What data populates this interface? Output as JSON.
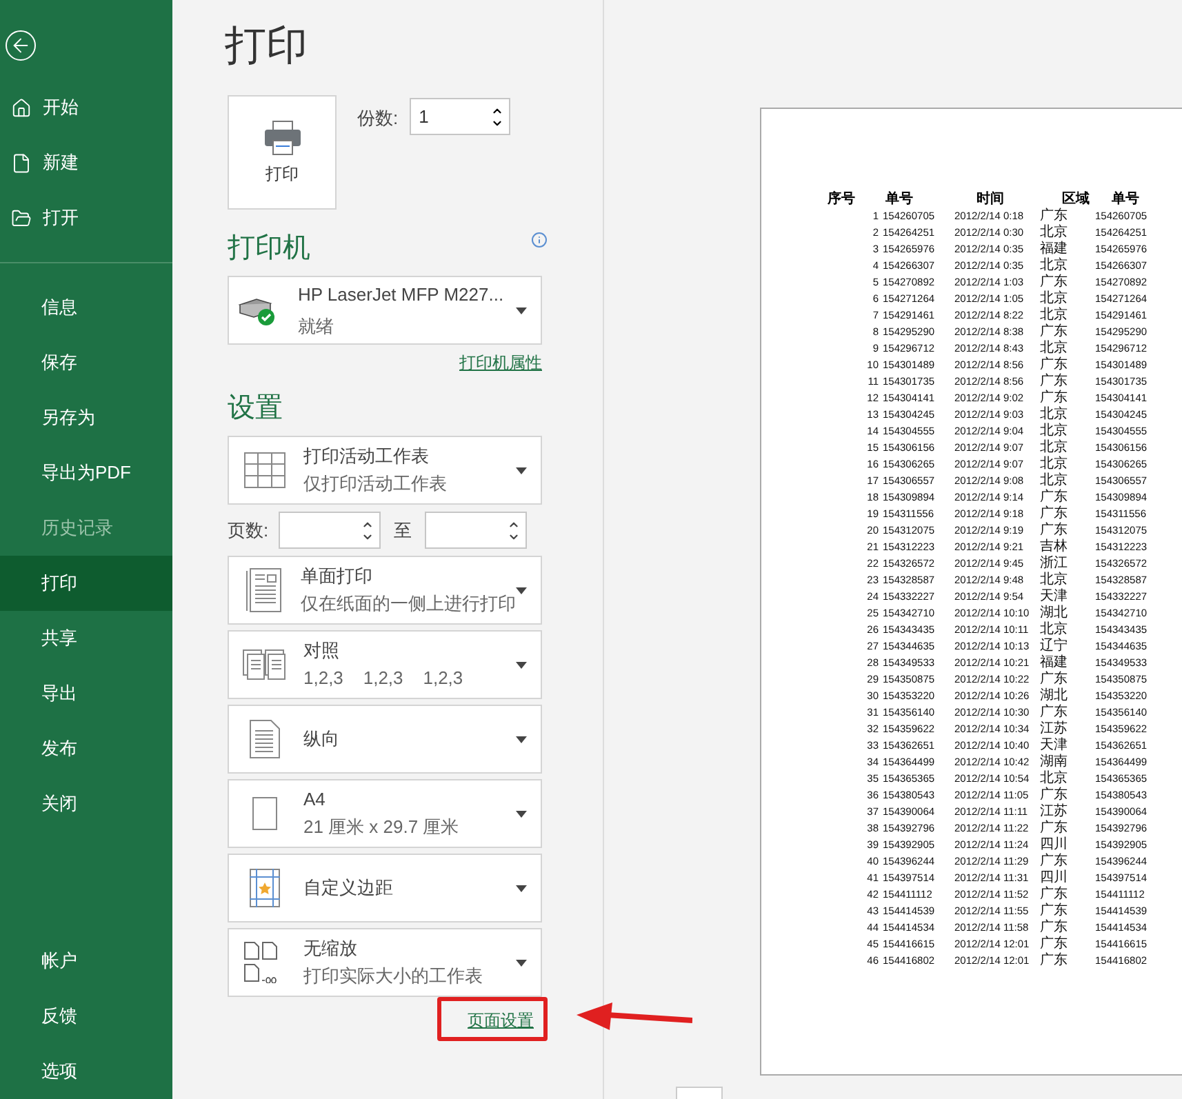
{
  "sidebar": {
    "top_items": [
      {
        "label": "开始",
        "kind": "home",
        "selected": false
      },
      {
        "label": "新建",
        "kind": "new",
        "selected": false
      },
      {
        "label": "打开",
        "kind": "open",
        "selected": false
      }
    ],
    "items": [
      {
        "label": "信息",
        "selected": false,
        "disabled": false
      },
      {
        "label": "保存",
        "selected": false,
        "disabled": false
      },
      {
        "label": "另存为",
        "selected": false,
        "disabled": false
      },
      {
        "label": "导出为PDF",
        "selected": false,
        "disabled": false
      },
      {
        "label": "历史记录",
        "selected": false,
        "disabled": true
      },
      {
        "label": "打印",
        "selected": true,
        "disabled": false
      },
      {
        "label": "共享",
        "selected": false,
        "disabled": false
      },
      {
        "label": "导出",
        "selected": false,
        "disabled": false
      },
      {
        "label": "发布",
        "selected": false,
        "disabled": false
      },
      {
        "label": "关闭",
        "selected": false,
        "disabled": false
      }
    ],
    "bottom_items": [
      {
        "label": "帐户",
        "selected": false
      },
      {
        "label": "反馈",
        "selected": false
      },
      {
        "label": "选项",
        "selected": false
      }
    ]
  },
  "title": "打印",
  "print_button": {
    "label": "打印"
  },
  "copies": {
    "label": "份数:",
    "value": "1"
  },
  "printer": {
    "heading": "打印机",
    "name": "HP LaserJet MFP M227...",
    "status": "就绪",
    "properties_link": "打印机属性"
  },
  "settings": {
    "heading": "设置",
    "options": [
      {
        "kind": "sheets",
        "title": "打印活动工作表",
        "subtitle": "仅打印活动工作表"
      },
      {
        "kind": "pages",
        "label": "页数:",
        "to": "至"
      },
      {
        "kind": "sides",
        "title": "单面打印",
        "subtitle": "仅在纸面的一侧上进行打印"
      },
      {
        "kind": "collate",
        "title": "对照",
        "subtitle": "1,2,3    1,2,3    1,2,3"
      },
      {
        "kind": "orientation",
        "title": "纵向"
      },
      {
        "kind": "paper",
        "title": "A4",
        "subtitle": "21 厘米 x 29.7 厘米"
      },
      {
        "kind": "margins",
        "title": "自定义边距"
      },
      {
        "kind": "scaling",
        "title": "无缩放",
        "subtitle": "打印实际大小的工作表"
      }
    ],
    "page_setup_link": "页面设置"
  },
  "preview": {
    "columns": [
      "序号",
      "单号",
      "时间",
      "区域",
      "单号"
    ],
    "rows": [
      [
        "1",
        "154260705",
        "2012/2/14 0:18",
        "广东",
        "154260705"
      ],
      [
        "2",
        "154264251",
        "2012/2/14 0:30",
        "北京",
        "154264251"
      ],
      [
        "3",
        "154265976",
        "2012/2/14 0:35",
        "福建",
        "154265976"
      ],
      [
        "4",
        "154266307",
        "2012/2/14 0:35",
        "北京",
        "154266307"
      ],
      [
        "5",
        "154270892",
        "2012/2/14 1:03",
        "广东",
        "154270892"
      ],
      [
        "6",
        "154271264",
        "2012/2/14 1:05",
        "北京",
        "154271264"
      ],
      [
        "7",
        "154291461",
        "2012/2/14 8:22",
        "北京",
        "154291461"
      ],
      [
        "8",
        "154295290",
        "2012/2/14 8:38",
        "广东",
        "154295290"
      ],
      [
        "9",
        "154296712",
        "2012/2/14 8:43",
        "北京",
        "154296712"
      ],
      [
        "10",
        "154301489",
        "2012/2/14 8:56",
        "广东",
        "154301489"
      ],
      [
        "11",
        "154301735",
        "2012/2/14 8:56",
        "广东",
        "154301735"
      ],
      [
        "12",
        "154304141",
        "2012/2/14 9:02",
        "广东",
        "154304141"
      ],
      [
        "13",
        "154304245",
        "2012/2/14 9:03",
        "北京",
        "154304245"
      ],
      [
        "14",
        "154304555",
        "2012/2/14 9:04",
        "北京",
        "154304555"
      ],
      [
        "15",
        "154306156",
        "2012/2/14 9:07",
        "北京",
        "154306156"
      ],
      [
        "16",
        "154306265",
        "2012/2/14 9:07",
        "北京",
        "154306265"
      ],
      [
        "17",
        "154306557",
        "2012/2/14 9:08",
        "北京",
        "154306557"
      ],
      [
        "18",
        "154309894",
        "2012/2/14 9:14",
        "广东",
        "154309894"
      ],
      [
        "19",
        "154311556",
        "2012/2/14 9:18",
        "广东",
        "154311556"
      ],
      [
        "20",
        "154312075",
        "2012/2/14 9:19",
        "广东",
        "154312075"
      ],
      [
        "21",
        "154312223",
        "2012/2/14 9:21",
        "吉林",
        "154312223"
      ],
      [
        "22",
        "154326572",
        "2012/2/14 9:45",
        "浙江",
        "154326572"
      ],
      [
        "23",
        "154328587",
        "2012/2/14 9:48",
        "北京",
        "154328587"
      ],
      [
        "24",
        "154332227",
        "2012/2/14 9:54",
        "天津",
        "154332227"
      ],
      [
        "25",
        "154342710",
        "2012/2/14 10:10",
        "湖北",
        "154342710"
      ],
      [
        "26",
        "154343435",
        "2012/2/14 10:11",
        "北京",
        "154343435"
      ],
      [
        "27",
        "154344635",
        "2012/2/14 10:13",
        "辽宁",
        "154344635"
      ],
      [
        "28",
        "154349533",
        "2012/2/14 10:21",
        "福建",
        "154349533"
      ],
      [
        "29",
        "154350875",
        "2012/2/14 10:22",
        "广东",
        "154350875"
      ],
      [
        "30",
        "154353220",
        "2012/2/14 10:26",
        "湖北",
        "154353220"
      ],
      [
        "31",
        "154356140",
        "2012/2/14 10:30",
        "广东",
        "154356140"
      ],
      [
        "32",
        "154359622",
        "2012/2/14 10:34",
        "江苏",
        "154359622"
      ],
      [
        "33",
        "154362651",
        "2012/2/14 10:40",
        "天津",
        "154362651"
      ],
      [
        "34",
        "154364499",
        "2012/2/14 10:42",
        "湖南",
        "154364499"
      ],
      [
        "35",
        "154365365",
        "2012/2/14 10:54",
        "北京",
        "154365365"
      ],
      [
        "36",
        "154380543",
        "2012/2/14 11:05",
        "广东",
        "154380543"
      ],
      [
        "37",
        "154390064",
        "2012/2/14 11:11",
        "江苏",
        "154390064"
      ],
      [
        "38",
        "154392796",
        "2012/2/14 11:22",
        "广东",
        "154392796"
      ],
      [
        "39",
        "154392905",
        "2012/2/14 11:24",
        "四川",
        "154392905"
      ],
      [
        "40",
        "154396244",
        "2012/2/14 11:29",
        "广东",
        "154396244"
      ],
      [
        "41",
        "154397514",
        "2012/2/14 11:31",
        "四川",
        "154397514"
      ],
      [
        "42",
        "154411112",
        "2012/2/14 11:52",
        "广东",
        "154411112"
      ],
      [
        "43",
        "154414539",
        "2012/2/14 11:55",
        "广东",
        "154414539"
      ],
      [
        "44",
        "154414534",
        "2012/2/14 11:58",
        "广东",
        "154414534"
      ],
      [
        "45",
        "154416615",
        "2012/2/14 12:01",
        "广东",
        "154416615"
      ],
      [
        "46",
        "154416802",
        "2012/2/14 12:01",
        "广东",
        "154416802"
      ]
    ]
  }
}
